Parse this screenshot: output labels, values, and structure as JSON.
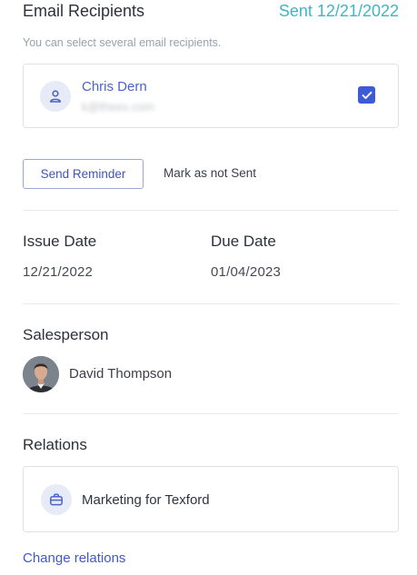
{
  "email_recipients": {
    "title": "Email Recipients",
    "sent_status": "Sent 12/21/2022",
    "hint": "You can select several email recipients.",
    "recipient": {
      "name": "Chris Dern",
      "email": "k@theex.com",
      "checked": true
    }
  },
  "actions": {
    "send_reminder": "Send Reminder",
    "mark_not_sent": "Mark as not Sent"
  },
  "dates": {
    "issue_label": "Issue Date",
    "issue_value": "12/21/2022",
    "due_label": "Due Date",
    "due_value": "01/04/2023"
  },
  "salesperson": {
    "label": "Salesperson",
    "name": "David Thompson"
  },
  "relations": {
    "label": "Relations",
    "item": "Marketing for Texford",
    "change_link": "Change relations"
  },
  "colors": {
    "accent": "#3d5bd6",
    "sent_teal": "#3fb6c2"
  },
  "icons": [
    "user-icon",
    "check-icon",
    "briefcase-icon"
  ]
}
